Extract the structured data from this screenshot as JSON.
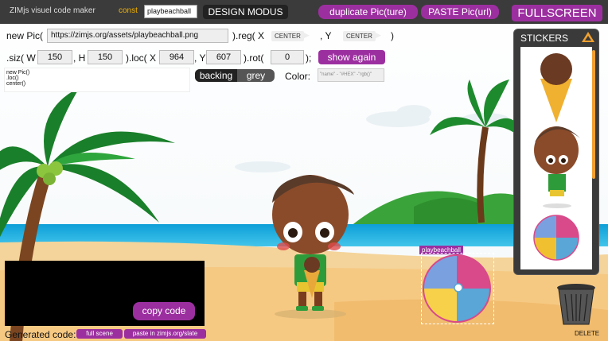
{
  "header": {
    "brand": "ZIMjs visuel code maker",
    "const_label": "const",
    "const_value": "playbeachball",
    "design_modus": "DESIGN MODUS",
    "duplicate": "duplicate Pic(ture)",
    "paste": "PASTE Pic(url)",
    "fullscreen": "FULLSCREEN"
  },
  "code_row1": {
    "new_pic": "new Pic(",
    "url": "https://zimjs.org/assets/playbeachball.png",
    "reg": ").reg( X",
    "reg_x": "CENTER",
    "comma_y": ", Y",
    "reg_y": "CENTER",
    "close": ")"
  },
  "code_row2": {
    "siz": ".siz( W",
    "w": "150",
    "h_label": ", H",
    "h": "150",
    "loc": ").loc( X",
    "x": "964",
    "y_label": ", Y",
    "y": "607",
    "rot": ").rot(",
    "rot_val": "0",
    "close": ");",
    "show_again": "show again"
  },
  "code_row3": {
    "backing": "backing",
    "grey": "grey",
    "color_label": "Color:",
    "color_placeholder": "\"name\" - \"#HEX\" -\"rgb()\""
  },
  "mini_code": [
    "new Pic()",
    ".loc()",
    "center()"
  ],
  "stickers": {
    "title": "STICKERS"
  },
  "scene": {
    "ball_label": "playbeachball"
  },
  "output": {
    "copy_code": "copy code"
  },
  "footer": {
    "generated": "Generated code:",
    "full_scene": "full scene",
    "paste_slate": "paste in zimjs.org/slate",
    "delete": "DELETE"
  },
  "colors": {
    "purple": "#9c2fa0",
    "dark": "#222222",
    "accent": "#f0a030"
  }
}
